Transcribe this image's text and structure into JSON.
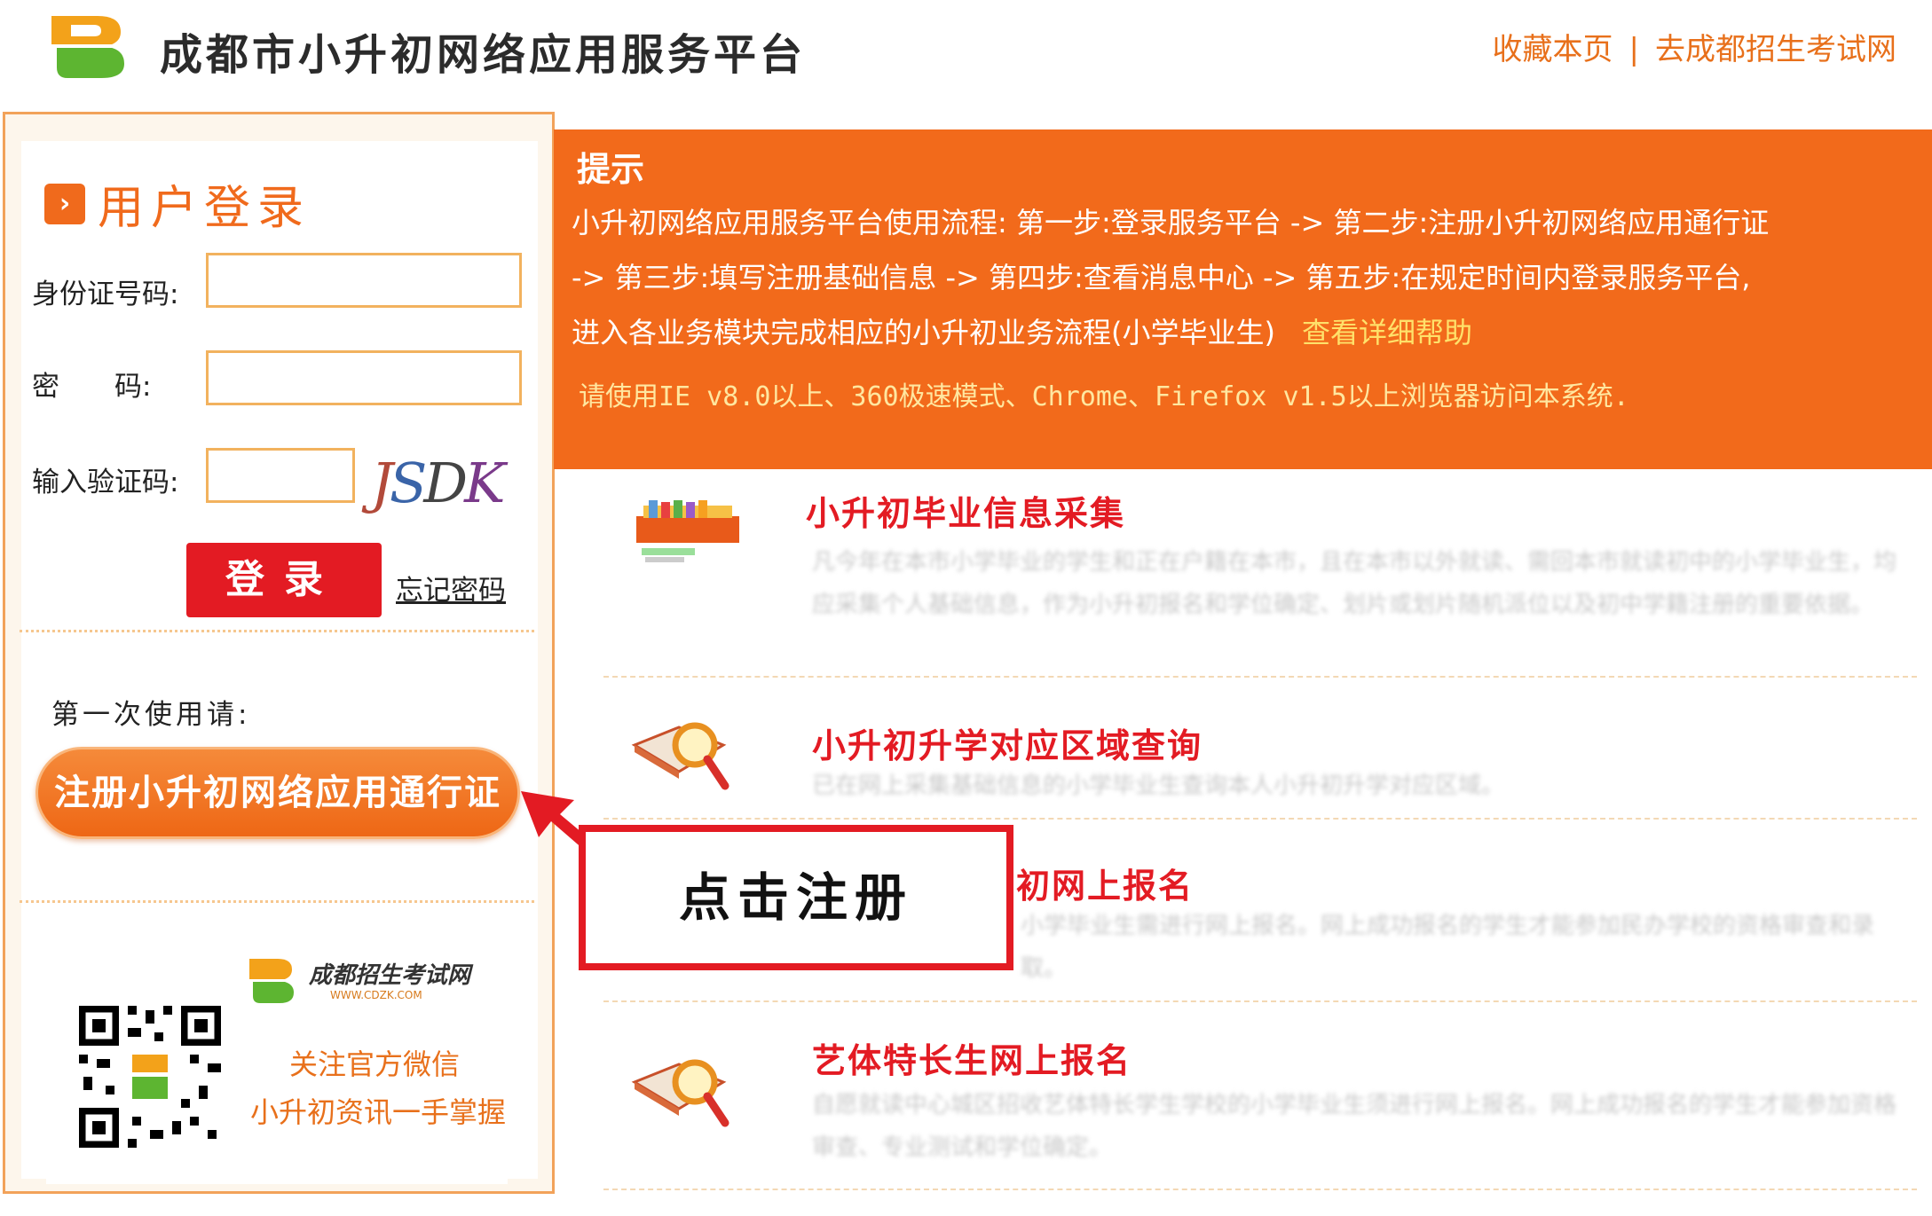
{
  "header": {
    "site_title": "成都市小升初网络应用服务平台",
    "links": {
      "bookmark": "收藏本页",
      "separator": "|",
      "goto_exam_site": "去成都招生考试网"
    }
  },
  "login": {
    "title": "用户登录",
    "id_label": "身份证号码:",
    "password_label": "密　　码:",
    "captcha_label": "输入验证码:",
    "captcha_text": [
      "J",
      "S",
      "D",
      "K"
    ],
    "login_button": "登录",
    "forgot_link": "忘记密码"
  },
  "first_use": {
    "label": "第一次使用请:",
    "register_button": "注册小升初网络应用通行证"
  },
  "wechat": {
    "logo_text": "成都招生考试网",
    "logo_sub": "WWW.CDZK.COM",
    "line1": "关注官方微信",
    "line2": "小升初资讯一手掌握"
  },
  "notice": {
    "title": "提示",
    "line1": "小升初网络应用服务平台使用流程:  第一步:登录服务平台 -> 第二步:注册小升初网络应用通行证",
    "line2": "-> 第三步:填写注册基础信息 -> 第四步:查看消息中心 -> 第五步:在规定时间内登录服务平台,",
    "line3": "进入各业务模块完成相应的小升初业务流程(小学毕业生)",
    "help_link": "查看详细帮助",
    "browser_note": "请使用IE v8.0以上、360极速模式、Chrome、Firefox v1.5以上浏览器访问本系统."
  },
  "items": [
    {
      "title": "小升初毕业信息采集",
      "desc": "凡今年在本市小学毕业的学生和正在户籍在本市，且在本市以外就读、需回本市就读初中的小学毕业生，均应采集个人基础信息，作为小升初报名和学位确定、划片或划片随机派位以及初中学籍注册的重要依据。"
    },
    {
      "title": "小升初升学对应区域查询",
      "desc": "已在网上采集基础信息的小学毕业生查询本人小升初升学对应区域。"
    },
    {
      "title": "初网上报名",
      "desc": "小学毕业生需进行网上报名。网上成功报名的学生才能参加民办学校的资格审查和录取。"
    },
    {
      "title": "艺体特长生网上报名",
      "desc": "自愿就读中心城区招收艺体特长学生学校的小学毕业生须进行网上报名。网上成功报名的学生才能参加资格审查、专业测试和学位确定。"
    }
  ],
  "annotation": {
    "callout_text": "点击注册"
  },
  "colors": {
    "brand_orange": "#f26a1b",
    "alert_red": "#e31b23",
    "link_orange": "#e8701b"
  }
}
